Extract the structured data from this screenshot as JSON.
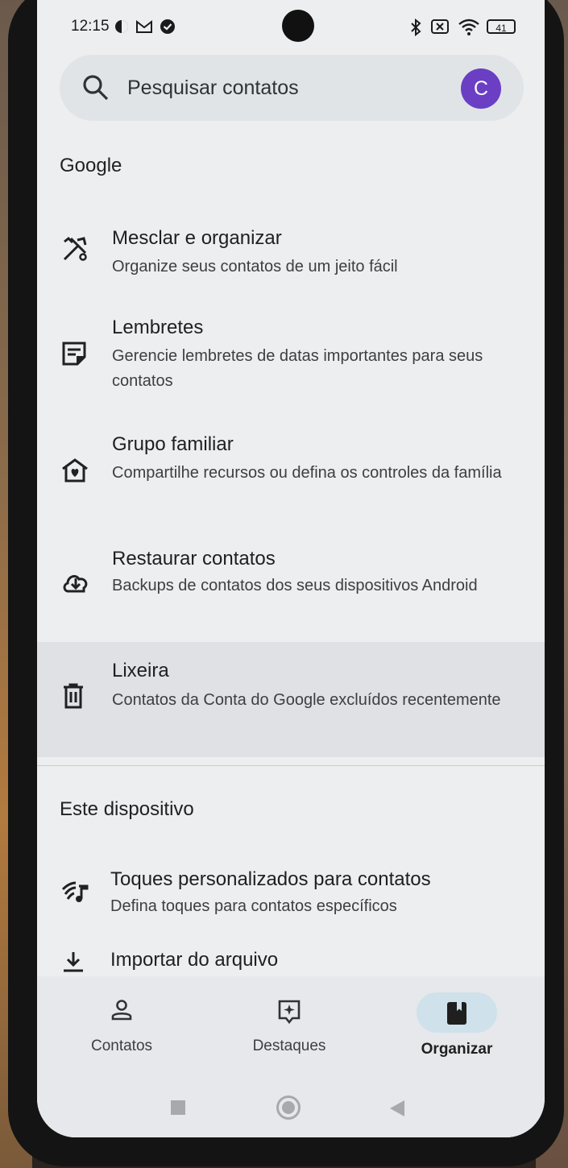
{
  "status_bar": {
    "time": "12:15",
    "icons": [
      "data-saver-icon",
      "gmail-icon",
      "check-circle-icon",
      "bluetooth-icon",
      "sim-off-icon",
      "wifi-icon",
      "battery-icon"
    ],
    "battery": "41"
  },
  "search": {
    "placeholder": "Pesquisar contatos",
    "avatar_letter": "C"
  },
  "sections": {
    "google": "Google",
    "device": "Este dispositivo"
  },
  "items": [
    {
      "icon": "merge-tools-icon",
      "title": "Mesclar e organizar",
      "subtitle": "Organize seus contatos de um jeito fácil"
    },
    {
      "icon": "reminder-note-icon",
      "title": "Lembretes",
      "subtitle": "Gerencie lembretes de datas importantes para seus contatos"
    },
    {
      "icon": "family-home-icon",
      "title": "Grupo familiar",
      "subtitle": "Compartilhe recursos ou defina os controles da família"
    },
    {
      "icon": "cloud-restore-icon",
      "title": "Restaurar contatos",
      "subtitle": "Backups de contatos dos seus dispositivos Android"
    },
    {
      "icon": "trash-icon",
      "title": "Lixeira",
      "subtitle": "Contatos da Conta do Google excluídos recentemente"
    },
    {
      "icon": "ringtone-icon",
      "title": "Toques personalizados para contatos",
      "subtitle": "Defina toques para contatos específicos"
    },
    {
      "icon": "download-icon",
      "title": "Importar do arquivo",
      "subtitle": ""
    }
  ],
  "bottom_nav": {
    "tabs": [
      {
        "label": "Contatos",
        "icon": "person-icon"
      },
      {
        "label": "Destaques",
        "icon": "highlights-icon"
      },
      {
        "label": "Organizar",
        "icon": "organize-bookmark-icon"
      }
    ],
    "active": "Organizar"
  },
  "colors": {
    "avatar": "#6a3fc4",
    "active_pill": "#cfe1ea",
    "background": "#eceef0"
  }
}
